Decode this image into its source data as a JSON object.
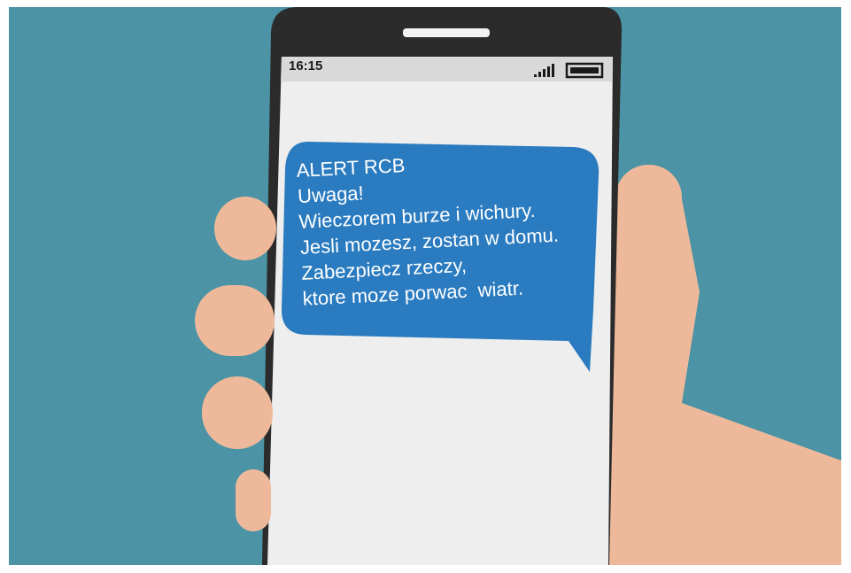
{
  "status_bar": {
    "time": "16:15",
    "signal_icon": "signal-bars-icon",
    "battery_icon": "battery-icon"
  },
  "message": {
    "lines": [
      "ALERT RCB",
      "Uwaga!",
      "Wieczorem burze i wichury.",
      "Jesli mozesz, zostan w domu.",
      "Zabezpiecz rzeczy,",
      "ktore moze porwac  wiatr."
    ]
  },
  "colors": {
    "background": "#4b93a5",
    "phone_body": "#2b2b2b",
    "screen": "#eeeeee",
    "status_bar": "#d9d9d9",
    "bubble": "#2a7bbf",
    "skin": "#eeb99a"
  }
}
